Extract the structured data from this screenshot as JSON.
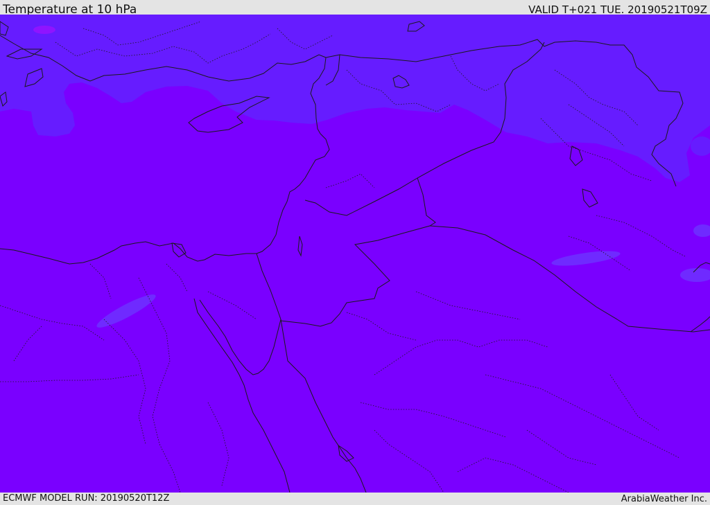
{
  "header": {
    "title": "Temperature at 10 hPa",
    "valid_time": "VALID T+021 TUE. 20190521T09Z"
  },
  "footer": {
    "model_run": "ECMWF MODEL RUN: 20190520T12Z",
    "credit": "ArabiaWeather Inc."
  },
  "map": {
    "region": "Eastern Mediterranean / Middle East",
    "fill_colors": {
      "dominant": "#7a00ff",
      "cooler_band": "#661cff",
      "cold_patch": "#6f2aff",
      "warm_patch": "#8f14ff"
    },
    "border_color": "#1a1a1a"
  }
}
